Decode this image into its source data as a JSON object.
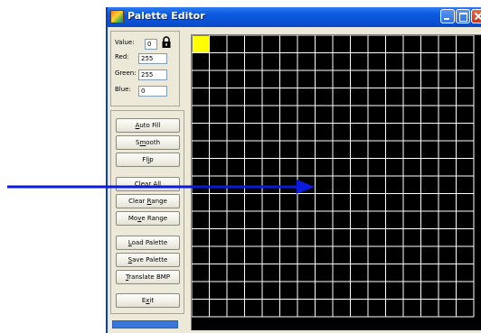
{
  "window": {
    "title": "Palette Editor"
  },
  "fields": {
    "value": {
      "label": "Value:",
      "value": "0"
    },
    "red": {
      "label": "Red:",
      "value": "255"
    },
    "green": {
      "label": "Green:",
      "value": "255"
    },
    "blue": {
      "label": "Blue:",
      "value": "0"
    }
  },
  "buttons": {
    "auto_fill": {
      "pre": "",
      "key": "A",
      "post": "uto Fill"
    },
    "smooth": {
      "pre": "S",
      "key": "m",
      "post": "ooth"
    },
    "flip": {
      "pre": "Fl",
      "key": "i",
      "post": "p"
    },
    "clear_all": {
      "pre": "Clear All",
      "key": "",
      "post": ""
    },
    "clear_range": {
      "pre": "Clear ",
      "key": "R",
      "post": "ange"
    },
    "move_range": {
      "pre": "Mo",
      "key": "v",
      "post": "e Range"
    },
    "load_palette": {
      "pre": "",
      "key": "L",
      "post": "oad Palette"
    },
    "save_palette": {
      "pre": "",
      "key": "S",
      "post": "ave Palette"
    },
    "translate_bmp": {
      "pre": "",
      "key": "T",
      "post": "ranslate BMP"
    },
    "exit": {
      "pre": "E",
      "key": "x",
      "post": "it"
    }
  },
  "palette": {
    "selected_index": 0,
    "selected_color": "#ffff00",
    "cell_color": "#000000",
    "grid_line_color": "#ffffff"
  },
  "icons": {
    "lock": "lock-icon"
  },
  "progress": {
    "fraction": 1.0
  },
  "annotation": {
    "arrow_color": "#0a1adf"
  }
}
